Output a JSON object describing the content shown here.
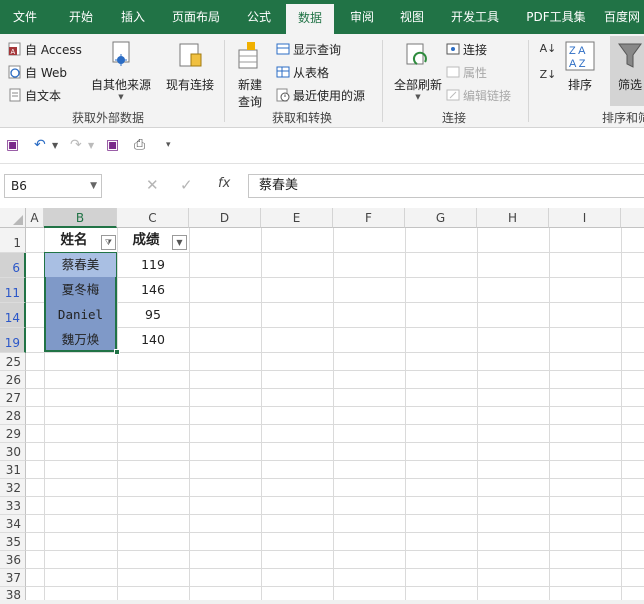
{
  "ribbon_tabs": [
    "文件",
    "开始",
    "插入",
    "页面布局",
    "公式",
    "数据",
    "审阅",
    "视图",
    "开发工具",
    "PDF工具集",
    "百度网"
  ],
  "active_tab": "数据",
  "ribbon": {
    "ext_data": {
      "access": "自 Access",
      "web": "自 Web",
      "text": "自文本",
      "other": "自其他来源",
      "existing": "现有连接",
      "label": "获取外部数据"
    },
    "transform": {
      "new_query": "新建\n查询",
      "new_query_l1": "新建",
      "new_query_l2": "查询",
      "show_query": "显示查询",
      "from_table": "从表格",
      "recent": "最近使用的源",
      "label": "获取和转换"
    },
    "connections": {
      "refresh_all": "全部刷新",
      "connections": "连接",
      "properties": "属性",
      "edit_links": "编辑链接",
      "label": "连接"
    },
    "sort_filter": {
      "sort": "排序",
      "filter": "筛选",
      "label": "排序和筛"
    }
  },
  "formula_bar": {
    "name_box": "B6",
    "formula_value": "蔡春美"
  },
  "grid": {
    "columns": [
      "A",
      "B",
      "C",
      "D",
      "E",
      "F",
      "G",
      "H",
      "I"
    ],
    "rows": [
      "1",
      "6",
      "11",
      "14",
      "19",
      "25",
      "26",
      "27",
      "28",
      "29",
      "30",
      "31",
      "32",
      "33",
      "34",
      "35",
      "36",
      "37",
      "38"
    ],
    "header": {
      "name": "姓名",
      "score": "成绩"
    },
    "records": [
      {
        "name": "蔡春美",
        "score": "119"
      },
      {
        "name": "夏冬梅",
        "score": "146"
      },
      {
        "name": "Daniel",
        "score": "95"
      },
      {
        "name": "魏万焕",
        "score": "140"
      }
    ]
  },
  "colors": {
    "accent": "#217346",
    "selection": "#7f99c8",
    "filtered_row_number": "#2b57c8"
  }
}
